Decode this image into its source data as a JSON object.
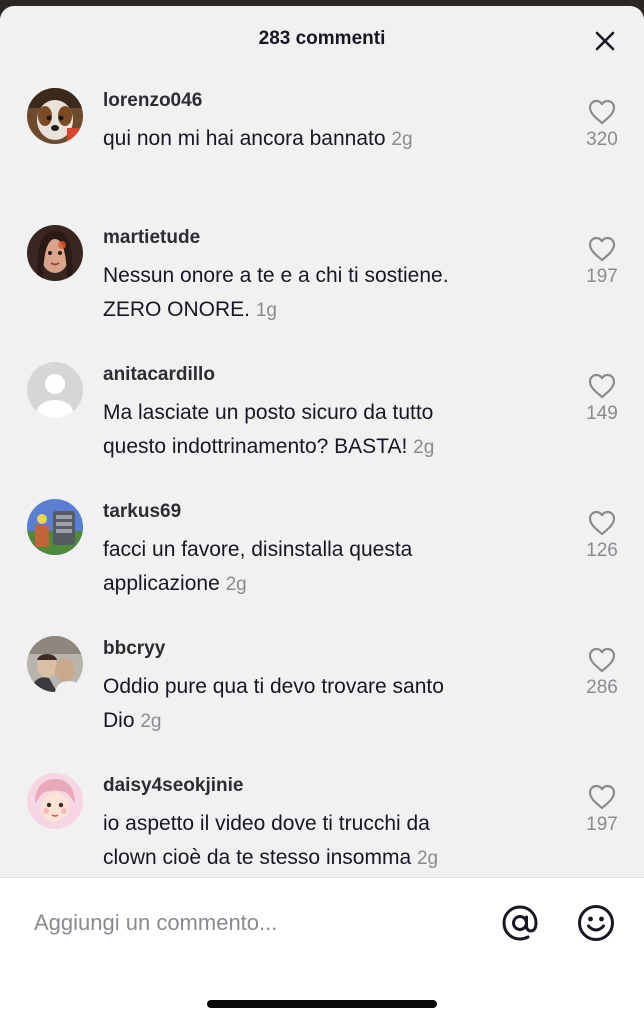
{
  "header": {
    "title": "283 commenti",
    "close_icon": "close-icon"
  },
  "comments": [
    {
      "username": "lorenzo046",
      "lines": [
        "qui non mi hai ancora bannato"
      ],
      "time": "2g",
      "likes": "320",
      "avatar_icon": "dog-photo-avatar"
    },
    {
      "username": "martietude",
      "lines": [
        "Nessun onore a te e a chi ti sostiene.",
        "ZERO ONORE."
      ],
      "time": "1g",
      "likes": "197",
      "avatar_icon": "woman-photo-avatar"
    },
    {
      "username": "anitacardillo",
      "lines": [
        "Ma lasciate un posto sicuro da tutto",
        "questo indottrinamento? BASTA!"
      ],
      "time": "2g",
      "likes": "149",
      "avatar_icon": "default-avatar"
    },
    {
      "username": "tarkus69",
      "lines": [
        "facci un favore, disinstalla questa",
        "applicazione"
      ],
      "time": "2g",
      "likes": "126",
      "avatar_icon": "robot-photo-avatar"
    },
    {
      "username": "bbcryy",
      "lines": [
        "Oddio pure qua ti devo trovare santo",
        "Dio"
      ],
      "time": "2g",
      "likes": "286",
      "avatar_icon": "people-photo-avatar"
    },
    {
      "username": "daisy4seokjinie",
      "lines": [
        "io aspetto il video dove ti trucchi da",
        "clown cioè da te stesso insomma"
      ],
      "time": "2g",
      "likes": "197",
      "avatar_icon": "cartoon-photo-avatar"
    }
  ],
  "footer": {
    "placeholder": "Aggiungi un commento...",
    "mention_icon": "at-sign-icon",
    "emoji_icon": "smiley-icon"
  },
  "colors": {
    "sheet_bg": "#f1f1f1",
    "text": "#161823",
    "secondary": "#8a8b91"
  }
}
